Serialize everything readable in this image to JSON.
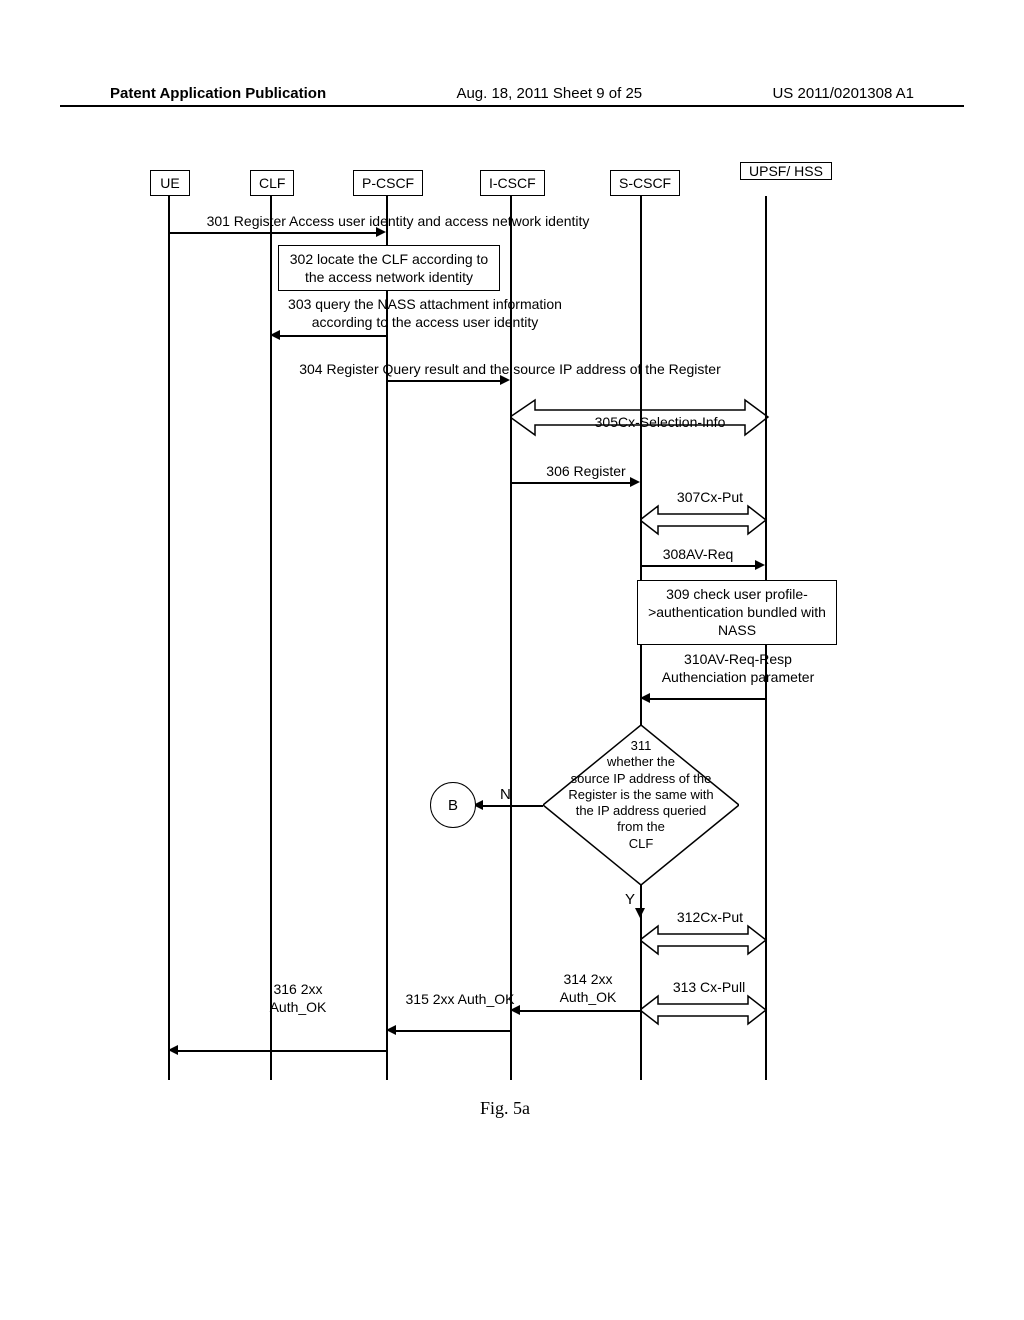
{
  "header": {
    "left": "Patent Application Publication",
    "center": "Aug. 18, 2011  Sheet 9 of 25",
    "right": "US 2011/0201308 A1"
  },
  "actors": {
    "ue": "UE",
    "clf": "CLF",
    "pcscf": "P-CSCF",
    "icscf": "I-CSCF",
    "scscf": "S-CSCF",
    "upsf": "UPSF/\nHSS"
  },
  "messages": {
    "m301": "301 Register Access user identity and access network identity",
    "m302": "302 locate the CLF according\nto the access network identity",
    "m303": "303 query the NASS attachment information\naccording to the access user identity",
    "m304": "304 Register Query result and the source IP address of the Register",
    "m305": "305Cx-Selection-Info",
    "m306": "306 Register",
    "m307": "307Cx-Put",
    "m308": "308AV-Req",
    "m309": "309 check user profile-\n>authentication bundled\nwith NASS",
    "m310": "310AV-Req-Resp\nAuthenciation parameter",
    "m311": "311\nwhether the\nsource IP address of the\nRegister is the same with\nthe IP address queried\nfrom the\nCLF",
    "m312": "312Cx-Put",
    "m313": "313 Cx-Pull",
    "m314": "314 2xx\nAuth_OK",
    "m315": "315 2xx Auth_OK",
    "m316": "316 2xx\nAuth_OK",
    "yes": "Y",
    "no": "N",
    "b": "B"
  },
  "figure_label": "Fig. 5a"
}
